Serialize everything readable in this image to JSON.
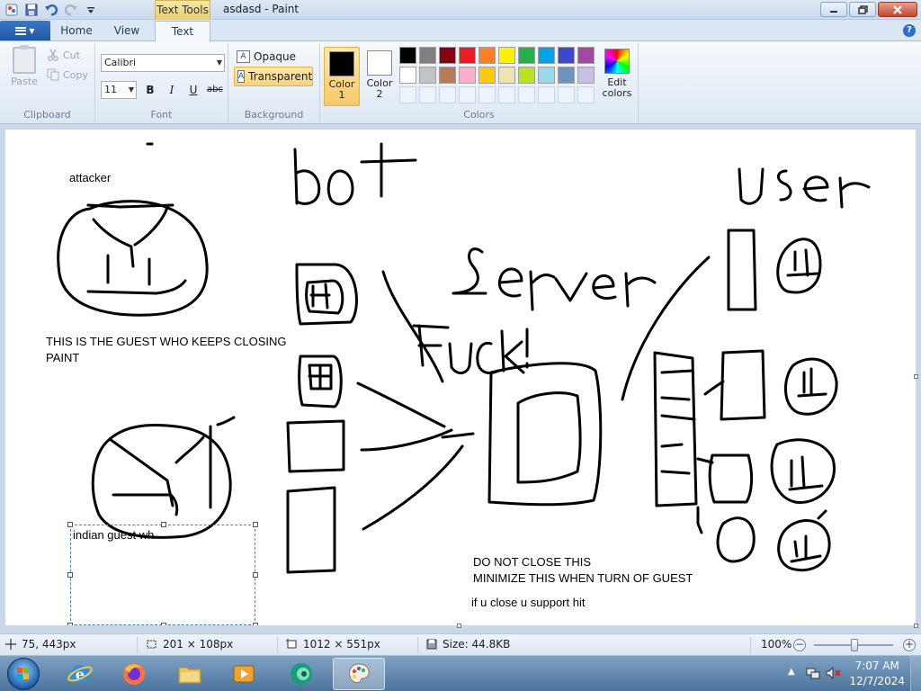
{
  "window": {
    "title": "asdasd - Paint",
    "context_tab": "Text Tools"
  },
  "tabs": {
    "home": "Home",
    "view": "View",
    "text": "Text",
    "active": "Text"
  },
  "clipboard": {
    "paste": "Paste",
    "cut": "Cut",
    "copy": "Copy",
    "label": "Clipboard"
  },
  "font": {
    "family": "Calibri",
    "size": "11",
    "bold": "B",
    "italic": "I",
    "underline": "U",
    "strikethrough": "abc",
    "label": "Font"
  },
  "background": {
    "opaque": "Opaque",
    "transparent": "Transparent",
    "selected": "Transparent",
    "label": "Background"
  },
  "colors": {
    "color1_label": "Color\n1",
    "color1_value": "#000000",
    "color2_label": "Color\n2",
    "color2_value": "#ffffff",
    "edit": "Edit colors",
    "label": "Colors",
    "palette_row1": [
      "#000000",
      "#7f7f7f",
      "#880015",
      "#ed1c24",
      "#ff7f27",
      "#fff200",
      "#22b14c",
      "#00a2e8",
      "#3f48cc",
      "#a349a4"
    ],
    "palette_row2": [
      "#ffffff",
      "#c3c3c3",
      "#b97a57",
      "#ffaec9",
      "#ffc90e",
      "#efe4b0",
      "#b5e61d",
      "#99d9ea",
      "#7092be",
      "#c8bfe7"
    ]
  },
  "canvas": {
    "texts": {
      "attacker": "attacker",
      "guest_note_1": "THIS IS THE GUEST WHO KEEPS  CLOSING",
      "guest_note_2": "PAINT",
      "textbox": "indian guest wh",
      "warn_1": "DO NOT CLOSE THIS",
      "warn_2": "MINIMIZE THIS WHEN TURN OF GUEST",
      "warn_3": "if u close u support hit"
    }
  },
  "status": {
    "cursor_pos": "75, 443px",
    "selection_size": "201 × 108px",
    "image_size": "1012 × 551px",
    "file_size": "Size: 44.8KB",
    "zoom": "100%"
  },
  "taskbar": {
    "time": "7:07 AM",
    "date": "12/7/2024"
  }
}
